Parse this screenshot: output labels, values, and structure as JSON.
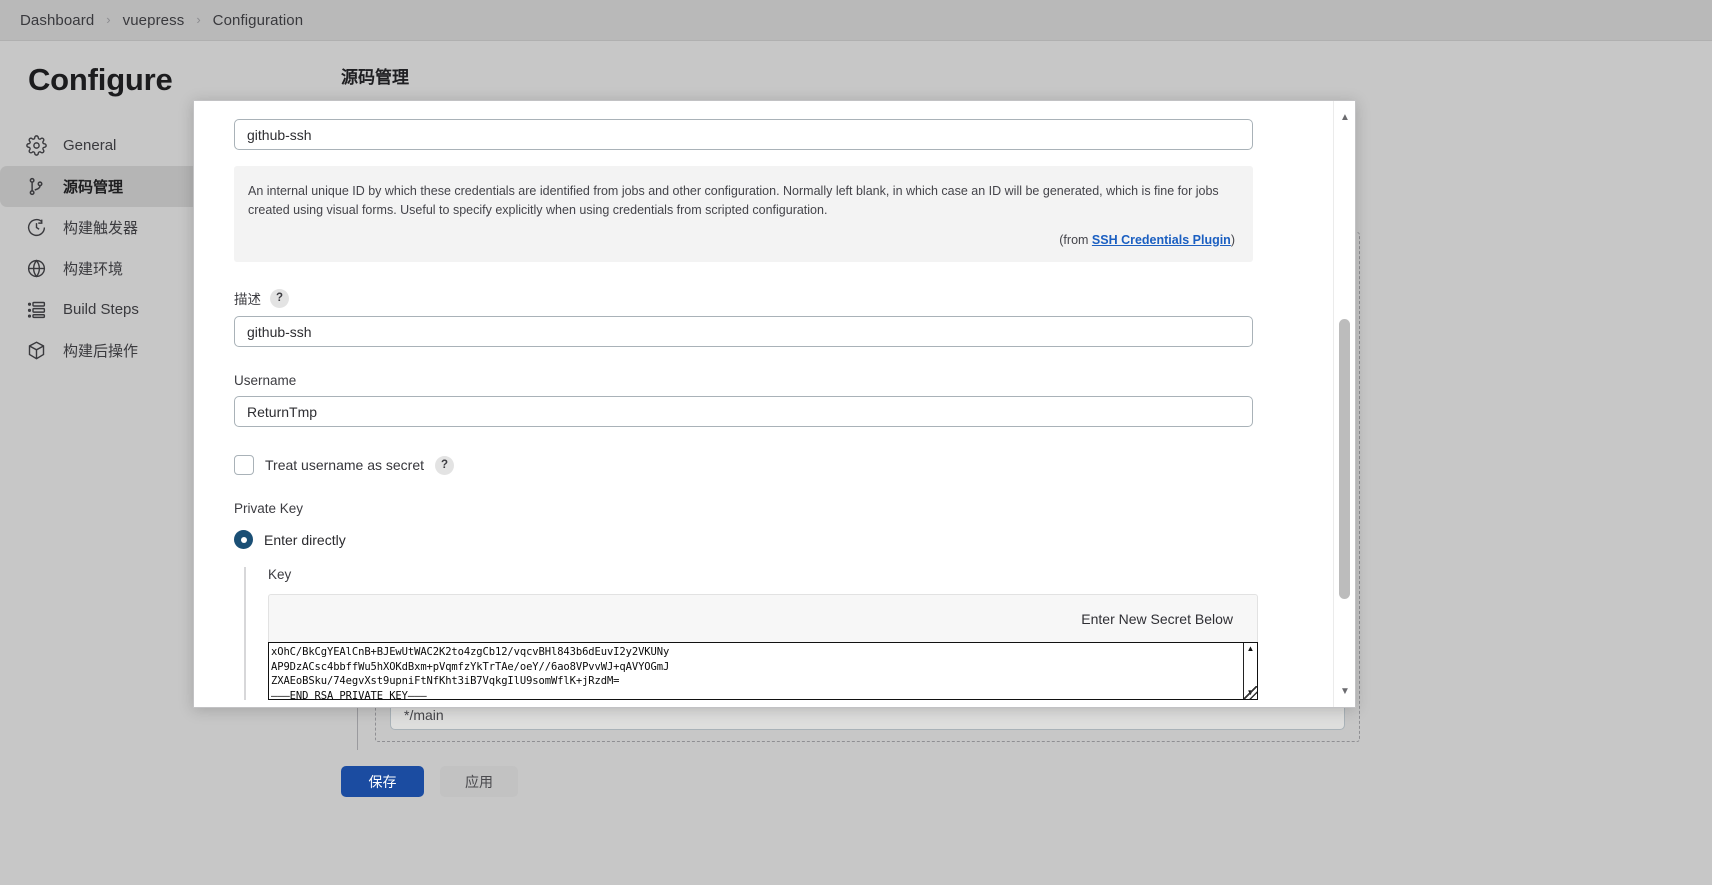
{
  "breadcrumb": {
    "items": [
      {
        "label": "Dashboard"
      },
      {
        "label": "vuepress"
      },
      {
        "label": "Configuration"
      }
    ],
    "separator": "›"
  },
  "page": {
    "title": "Configure",
    "section_heading": "源码管理"
  },
  "sidebar": {
    "items": [
      {
        "label": "General",
        "icon": "gear-icon",
        "active": false
      },
      {
        "label": "源码管理",
        "icon": "source-branch-icon",
        "active": true
      },
      {
        "label": "构建触发器",
        "icon": "clock-icon",
        "active": false
      },
      {
        "label": "构建环境",
        "icon": "globe-icon",
        "active": false
      },
      {
        "label": "Build Steps",
        "icon": "list-icon",
        "active": false
      },
      {
        "label": "构建后操作",
        "icon": "package-icon",
        "active": false
      }
    ]
  },
  "background_form": {
    "branch_field_value": "*/main"
  },
  "footer": {
    "save_label": "保存",
    "apply_label": "应用"
  },
  "modal": {
    "id_field": {
      "value": "github-ssh",
      "placeholder": ""
    },
    "id_help": {
      "text": "An internal unique ID by which these credentials are identified from jobs and other configuration. Normally left blank, in which case an ID will be generated, which is fine for jobs created using visual forms. Useful to specify explicitly when using credentials from scripted configuration.",
      "from_prefix": "(from ",
      "from_link": "SSH Credentials Plugin",
      "from_suffix": ")"
    },
    "description": {
      "label": "描述",
      "help_badge": "?",
      "value": "github-ssh"
    },
    "username": {
      "label": "Username",
      "value": "ReturnTmp"
    },
    "treat_username_as_secret": {
      "label": "Treat username as secret",
      "help_badge": "?",
      "checked": false
    },
    "private_key": {
      "label": "Private Key",
      "option_label": "Enter directly",
      "option_selected": true,
      "key_label": "Key",
      "secret_banner": "Enter New Secret Below",
      "key_value": "xOhC/BkCgYEAlCnB+BJEwUtWAC2K2to4zgCb12/vqcvBHl843b6dEuvI2y2VKUNy\nAP9DzACsc4bbffWu5hXOKdBxm+pVqmfzYkTrTAe/oeY//6ao8VPvvWJ+qAVYOGmJ\nZXAEoBSku/74egvXst9upniFtNfKht3iB7VqkgIlU9somWflK+jRzdM=\n———END RSA PRIVATE KEY———"
    }
  },
  "colors": {
    "accent_blue": "#1b4ca1",
    "link_blue": "#1b5fc1",
    "radio_selected": "#1a4f75",
    "page_bg": "#c7c7c7",
    "modal_bg": "#ffffff"
  }
}
